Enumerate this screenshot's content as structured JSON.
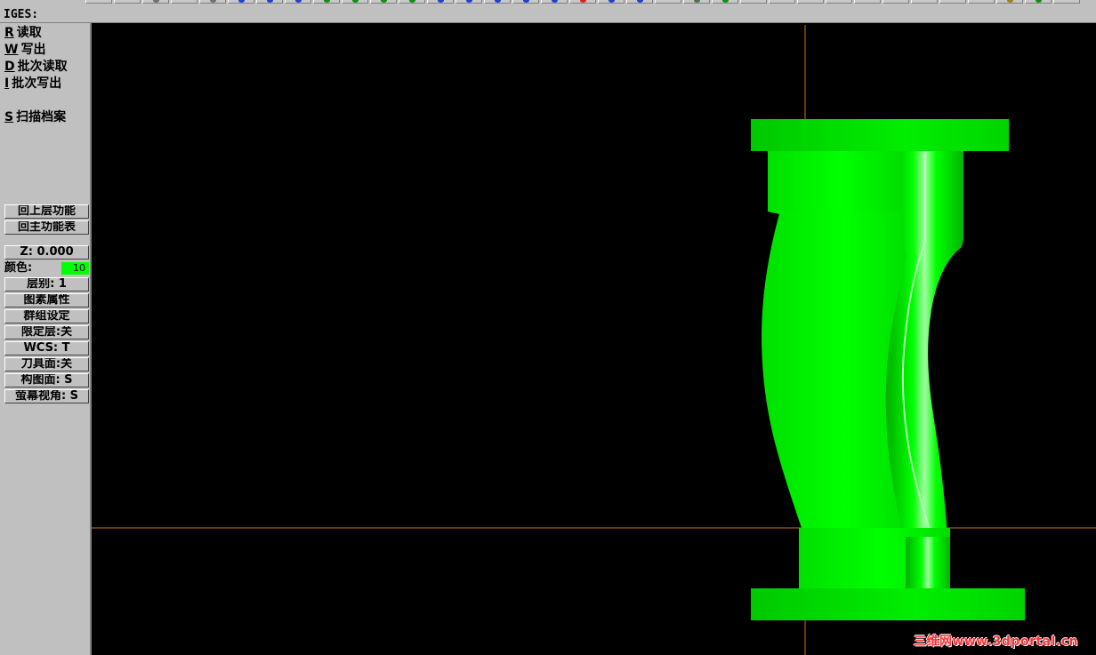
{
  "prompt": {
    "label": "IGES:"
  },
  "menu": [
    {
      "key": "R",
      "label": "读取"
    },
    {
      "key": "W",
      "label": "写出"
    },
    {
      "key": "D",
      "label": "批次读取"
    },
    {
      "key": "I",
      "label": "批次写出"
    },
    {
      "key": "S",
      "label": "扫描档案"
    }
  ],
  "nav": {
    "back": "回上层功能",
    "main": "回主功能表"
  },
  "status": {
    "z": "Z:  0.000",
    "color_label": "颜色:",
    "color_value": "10",
    "level": "层别: 1",
    "attributes": "图素属性",
    "group": "群组设定",
    "mask": "限定层:关",
    "wcs": "WCS:  T",
    "tplane": "刀具面:关",
    "cplane": "构图面: S",
    "gview": "萤幕视角: S"
  },
  "colors": {
    "model": "#00ff00",
    "crosshair": "#c87020",
    "background": "#000000",
    "panel": "#c0c0c0"
  },
  "toolbar_icons": [
    "new-icon",
    "open-icon",
    "zoom-icon",
    "undo-icon",
    "redo-icon",
    "view-icon",
    "view-icon",
    "view-icon",
    "view-icon",
    "view-icon",
    "view-icon",
    "stop-icon",
    "arrow-icon",
    "arrow-icon"
  ],
  "watermark": "三维网www.3dportal.cn"
}
